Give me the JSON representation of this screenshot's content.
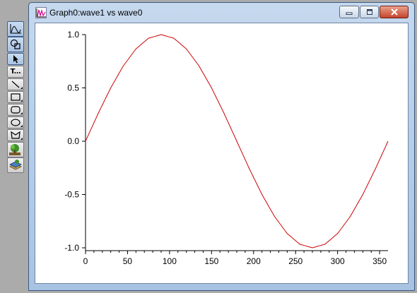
{
  "window": {
    "title": "Graph0:wave1 vs wave0"
  },
  "toolbar": {
    "tools": [
      {
        "name": "graph-mode-tool",
        "icon": "graph-icon"
      },
      {
        "name": "drawing-mode-tool",
        "icon": "shapes-icon"
      },
      {
        "name": "arrow-tool",
        "icon": "arrow-pointer-icon"
      },
      {
        "name": "text-tool",
        "icon": "text-tool-icon",
        "label": "T..."
      },
      {
        "name": "line-tool",
        "icon": "line-icon"
      },
      {
        "name": "rectangle-tool",
        "icon": "rectangle-icon"
      },
      {
        "name": "rounded-rectangle-tool",
        "icon": "rounded-rectangle-icon"
      },
      {
        "name": "oval-tool",
        "icon": "oval-icon"
      },
      {
        "name": "polygon-tool",
        "icon": "polygon-icon"
      },
      {
        "name": "picture-tool",
        "icon": "tree-picture-icon"
      },
      {
        "name": "annotation-tool",
        "icon": "stack-picture-icon"
      }
    ]
  },
  "colors": {
    "trace": "#cc0000",
    "axis": "#000000",
    "plot_background": "#ffffff"
  },
  "chart_data": {
    "type": "line",
    "title": "",
    "xlabel": "",
    "ylabel": "",
    "xlim": [
      0,
      360
    ],
    "ylim": [
      -1.0,
      1.0
    ],
    "grid": false,
    "xticks": [
      0,
      50,
      100,
      150,
      200,
      250,
      300,
      350
    ],
    "xtick_labels": [
      "0",
      "50",
      "100",
      "150",
      "200",
      "250",
      "300",
      "350"
    ],
    "yticks": [
      1.0,
      0.5,
      0.0,
      -0.5,
      -1.0
    ],
    "ytick_labels": [
      "1.0",
      "0.5",
      "0.0",
      "-0.5",
      "-1.0"
    ],
    "series": [
      {
        "x": [
          0,
          15,
          30,
          45,
          60,
          75,
          90,
          105,
          120,
          135,
          150,
          165,
          180,
          195,
          210,
          225,
          240,
          255,
          270,
          285,
          300,
          315,
          330,
          345,
          360
        ],
        "y": [
          0.0,
          0.259,
          0.5,
          0.707,
          0.866,
          0.966,
          1.0,
          0.966,
          0.866,
          0.707,
          0.5,
          0.259,
          0.0,
          -0.259,
          -0.5,
          -0.707,
          -0.866,
          -0.966,
          -1.0,
          -0.966,
          -0.866,
          -0.707,
          -0.5,
          -0.259,
          0.0
        ]
      }
    ]
  }
}
